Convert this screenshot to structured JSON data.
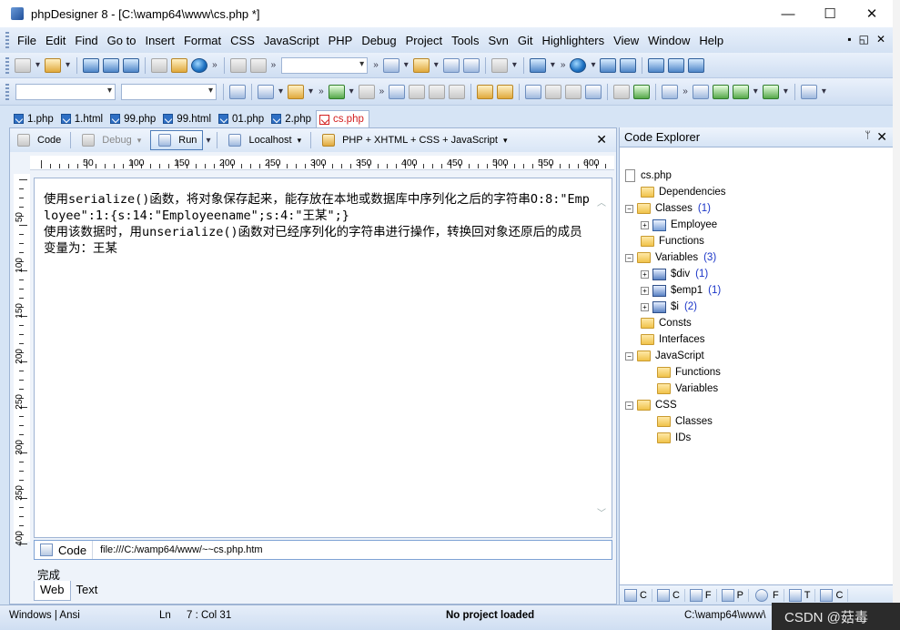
{
  "window": {
    "title": "phpDesigner 8 - [C:\\wamp64\\www\\cs.php *]",
    "minimize": "—",
    "maximize": "☐",
    "close": "✕"
  },
  "menu": {
    "items": [
      "File",
      "Edit",
      "Find",
      "Go to",
      "Insert",
      "Format",
      "CSS",
      "JavaScript",
      "PHP",
      "Debug",
      "Project",
      "Tools",
      "Svn",
      "Git",
      "Highlighters",
      "View",
      "Window",
      "Help"
    ],
    "right_controls": [
      "▪",
      "◱",
      "✕"
    ]
  },
  "tabs": [
    "1.php",
    "1.html",
    "99.php",
    "99.html",
    "01.php",
    "2.php",
    "cs.php"
  ],
  "active_tab": "cs.php",
  "editor_toolbar": {
    "code": "Code",
    "debug": "Debug",
    "run": "Run",
    "localhost": "Localhost",
    "mode": "PHP + XHTML + CSS + JavaScript",
    "close": "✕"
  },
  "ruler": {
    "labels": [
      "50",
      "100",
      "150",
      "200",
      "250",
      "300",
      "350",
      "400",
      "450",
      "500",
      "550",
      "600"
    ],
    "vlabels": [
      "50",
      "100",
      "150",
      "200",
      "250",
      "300",
      "350",
      "400"
    ]
  },
  "editor": {
    "text": "使用serialize()函数，将对象保存起来，能存放在本地或数据库中序列化之后的字符串O:8:\"Employee\":1:{s:14:\"Employeename\";s:4:\"王某\";}\n使用该数据时，用unserialize()函数对已经序列化的字符串进行操作，转换回对象还原后的成员变量为：王某"
  },
  "browser_bar": {
    "code_tab": "Code",
    "url": "file:///C:/wamp64/www/~~cs.php.htm",
    "status": "完成",
    "tab_web": "Web",
    "tab_text": "Text"
  },
  "explorer": {
    "title": "Code Explorer",
    "pin": "ᛘ",
    "close": "✕",
    "root": "cs.php",
    "dependencies": "Dependencies",
    "classes": "Classes",
    "classes_count": "(1)",
    "employee": "Employee",
    "functions": "Functions",
    "variables": "Variables",
    "variables_count": "(3)",
    "var_div": "$div",
    "var_div_count": "(1)",
    "var_emp1": "$emp1",
    "var_emp1_count": "(1)",
    "var_i": "$i",
    "var_i_count": "(2)",
    "consts": "Consts",
    "interfaces": "Interfaces",
    "javascript": "JavaScript",
    "js_functions": "Functions",
    "js_variables": "Variables",
    "css": "CSS",
    "css_classes": "Classes",
    "css_ids": "IDs",
    "bottom_tabs": [
      "C",
      "C",
      "F",
      "P",
      "F",
      "T",
      "C"
    ]
  },
  "statusbar": {
    "encoding": "Windows | Ansi",
    "ln_label": "Ln",
    "position": "7 : Col  31",
    "project": "No project loaded",
    "path": "C:\\wamp64\\www\\"
  },
  "watermark": "CSDN @菇毒"
}
